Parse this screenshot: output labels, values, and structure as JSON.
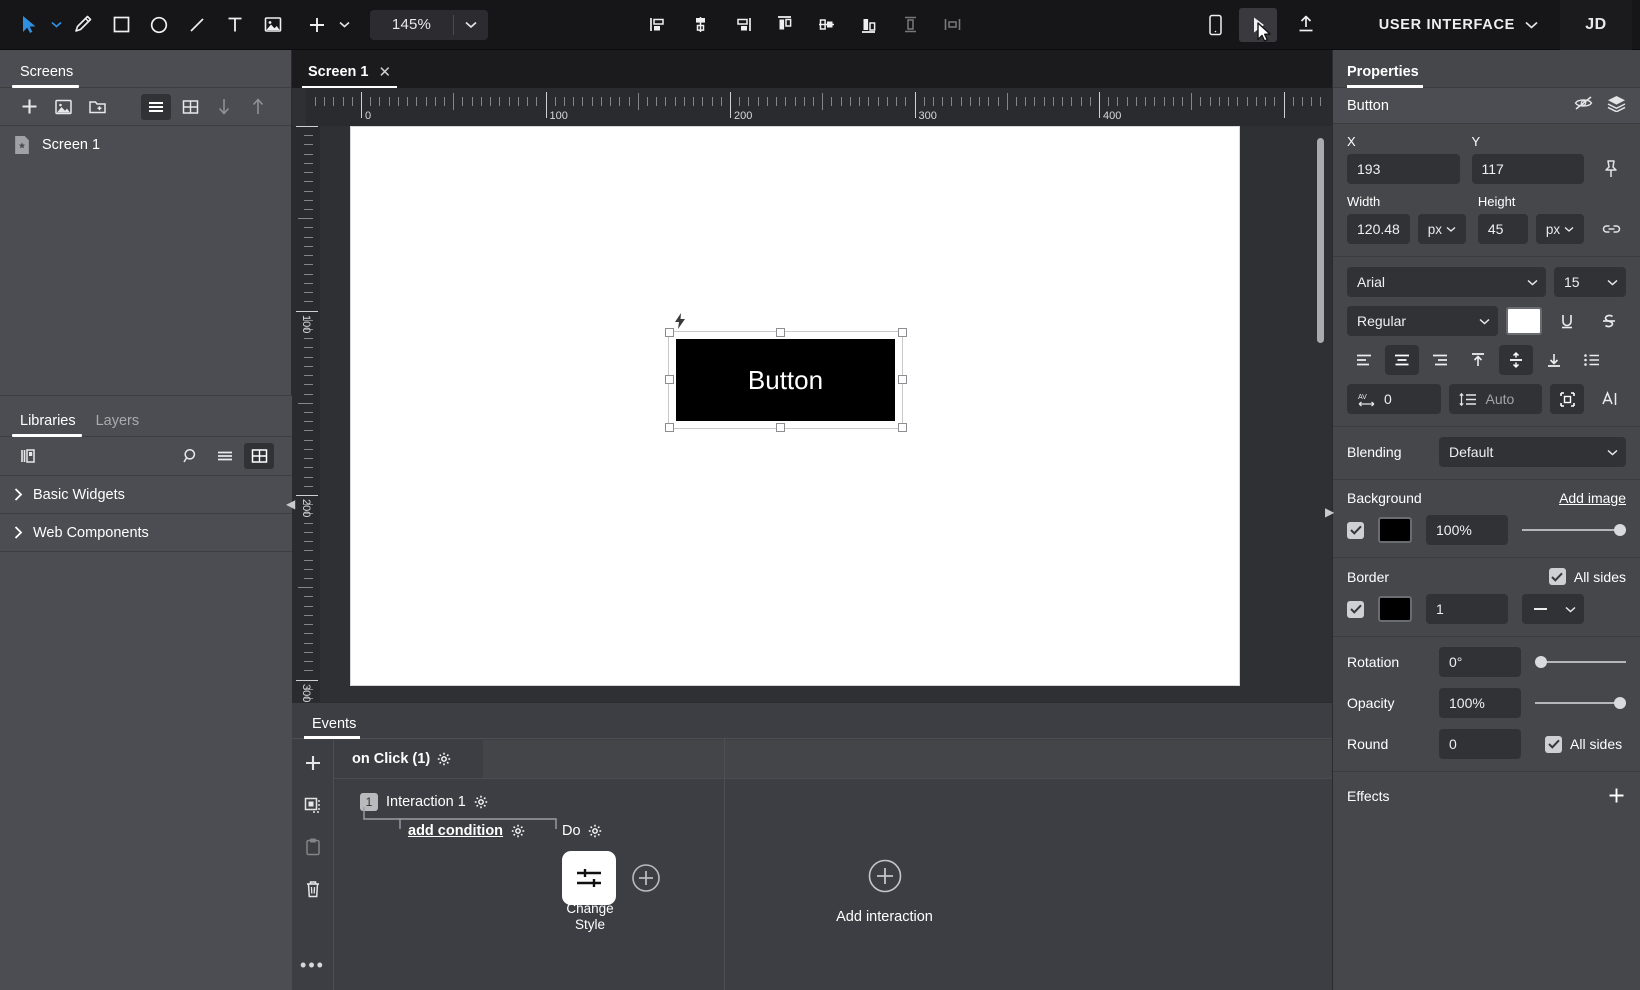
{
  "toolbar": {
    "tools": [
      {
        "name": "select-tool",
        "icon": "cursor-arrow-icon"
      },
      {
        "name": "pen-tool",
        "icon": "pen-icon"
      },
      {
        "name": "rectangle-tool",
        "icon": "square-icon"
      },
      {
        "name": "ellipse-tool",
        "icon": "circle-icon"
      },
      {
        "name": "line-tool",
        "icon": "line-icon"
      },
      {
        "name": "text-tool",
        "icon": "text-t-icon"
      },
      {
        "name": "image-tool",
        "icon": "image-icon"
      },
      {
        "name": "add-tool",
        "icon": "plus-icon"
      }
    ],
    "zoom_value": "145%",
    "align_tools": [
      {
        "name": "align-left",
        "icon": "align-left-icon"
      },
      {
        "name": "align-center-horizontal",
        "icon": "align-center-h-icon"
      },
      {
        "name": "align-right",
        "icon": "align-right-icon"
      },
      {
        "name": "align-top",
        "icon": "align-top-icon"
      },
      {
        "name": "align-middle-vertical",
        "icon": "align-middle-v-icon"
      },
      {
        "name": "align-bottom",
        "icon": "align-bottom-icon"
      },
      {
        "name": "distribute-vertical",
        "icon": "distribute-v-icon"
      },
      {
        "name": "distribute-horizontal",
        "icon": "distribute-h-icon"
      }
    ],
    "preview_device": "mobile-preview-icon",
    "play": "play-preview-icon",
    "share": "upload-share-icon",
    "account_name": "USER INTERFACE",
    "avatar_initials": "JD"
  },
  "screens_panel": {
    "tab_label": "Screens",
    "actions": [
      {
        "name": "add-screen-button",
        "icon": "plus-icon"
      },
      {
        "name": "add-image-screen-button",
        "icon": "image-icon"
      },
      {
        "name": "add-folder-button",
        "icon": "folder-plus-icon"
      }
    ],
    "view_list": "list-view-icon",
    "view_grid": "grid-view-icon",
    "sort_down": "arrow-down-icon",
    "sort_up": "arrow-up-icon",
    "items": [
      {
        "label": "Screen 1",
        "icon": "screen-doc-icon"
      }
    ]
  },
  "libraries_panel": {
    "tabs": [
      {
        "label": "Libraries",
        "selected": true
      },
      {
        "label": "Layers",
        "selected": false
      }
    ],
    "toolbar": {
      "library_icon": "library-books-icon",
      "search": "search-icon",
      "list_view": "list-view-icon",
      "grid_view": "grid-view-icon"
    },
    "groups": [
      {
        "label": "Basic Widgets"
      },
      {
        "label": "Web Components"
      }
    ]
  },
  "canvas": {
    "tab_label": "Screen 1",
    "tab_close": "✕",
    "ruler_h_labels": [
      "0",
      "100",
      "200",
      "300",
      "400"
    ],
    "ruler_v_labels": [
      "100",
      "200",
      "300"
    ],
    "element": {
      "label": "Button",
      "text_color": "#ffffff",
      "fill_color": "#000000"
    }
  },
  "events_panel": {
    "tab_label": "Events",
    "sidebar_actions": [
      {
        "name": "add-event-button",
        "icon": "plus-icon"
      },
      {
        "name": "copy-event-button",
        "icon": "copy-dashed-icon"
      },
      {
        "name": "paste-event-button",
        "icon": "clipboard-icon"
      },
      {
        "name": "delete-event-button",
        "icon": "trash-icon"
      }
    ],
    "more_label": "•••",
    "event_title": "on Click (1)",
    "interaction_badge": "1",
    "interaction_title": "Interaction 1",
    "add_condition": "add condition",
    "do_label": "Do",
    "action_label": "Change Style",
    "action_icon": "sliders-icon",
    "add_action_icon": "plus-circle-icon",
    "add_interaction_label": "Add interaction",
    "add_interaction_icon": "plus-circle-icon"
  },
  "properties": {
    "tab_label": "Properties",
    "object_name": "Button",
    "object_actions": [
      {
        "name": "hide-object-button",
        "icon": "eye-off-icon"
      },
      {
        "name": "layers-button",
        "icon": "layers-icon"
      }
    ],
    "position": {
      "x_label": "X",
      "x_value": "193",
      "y_label": "Y",
      "y_value": "117",
      "pin_icon": "pin-icon"
    },
    "size": {
      "width_label": "Width",
      "width_value": "120.48",
      "width_unit": "px",
      "height_label": "Height",
      "height_value": "45",
      "height_unit": "px",
      "link_icon": "link-chain-icon"
    },
    "typography": {
      "font_family": "Arial",
      "font_size": "15",
      "font_weight": "Regular",
      "color_swatch": "#ffffff",
      "underline_icon": "underline-icon",
      "strikethrough_icon": "strikethrough-icon",
      "align_left": "text-align-left-icon",
      "align_center": "text-align-center-icon",
      "align_right": "text-align-right-icon",
      "valign_top": "valign-top-icon",
      "valign_middle": "valign-middle-icon",
      "valign_bottom": "valign-bottom-icon",
      "list_icon": "bullet-list-icon",
      "letter_spacing_value": "0",
      "letter_spacing_icon": "letter-spacing-icon",
      "line_height_value": "Auto",
      "line_height_icon": "line-height-icon",
      "autofit_icon": "autofit-icon",
      "text_direction_icon": "text-direction-icon"
    },
    "blending": {
      "label": "Blending",
      "value": "Default"
    },
    "background": {
      "label": "Background",
      "add_image_label": "Add image",
      "enabled": true,
      "color": "#000000",
      "opacity": "100%"
    },
    "border": {
      "label": "Border",
      "all_sides_label": "All sides",
      "all_sides_checked": true,
      "enabled": true,
      "color": "#000000",
      "width": "1",
      "style": "solid"
    },
    "rotation": {
      "label": "Rotation",
      "value": "0°"
    },
    "opacity": {
      "label": "Opacity",
      "value": "100%"
    },
    "round": {
      "label": "Round",
      "value": "0",
      "all_sides_label": "All sides",
      "all_sides_checked": true
    },
    "effects": {
      "label": "Effects",
      "add_icon": "plus-icon"
    }
  }
}
